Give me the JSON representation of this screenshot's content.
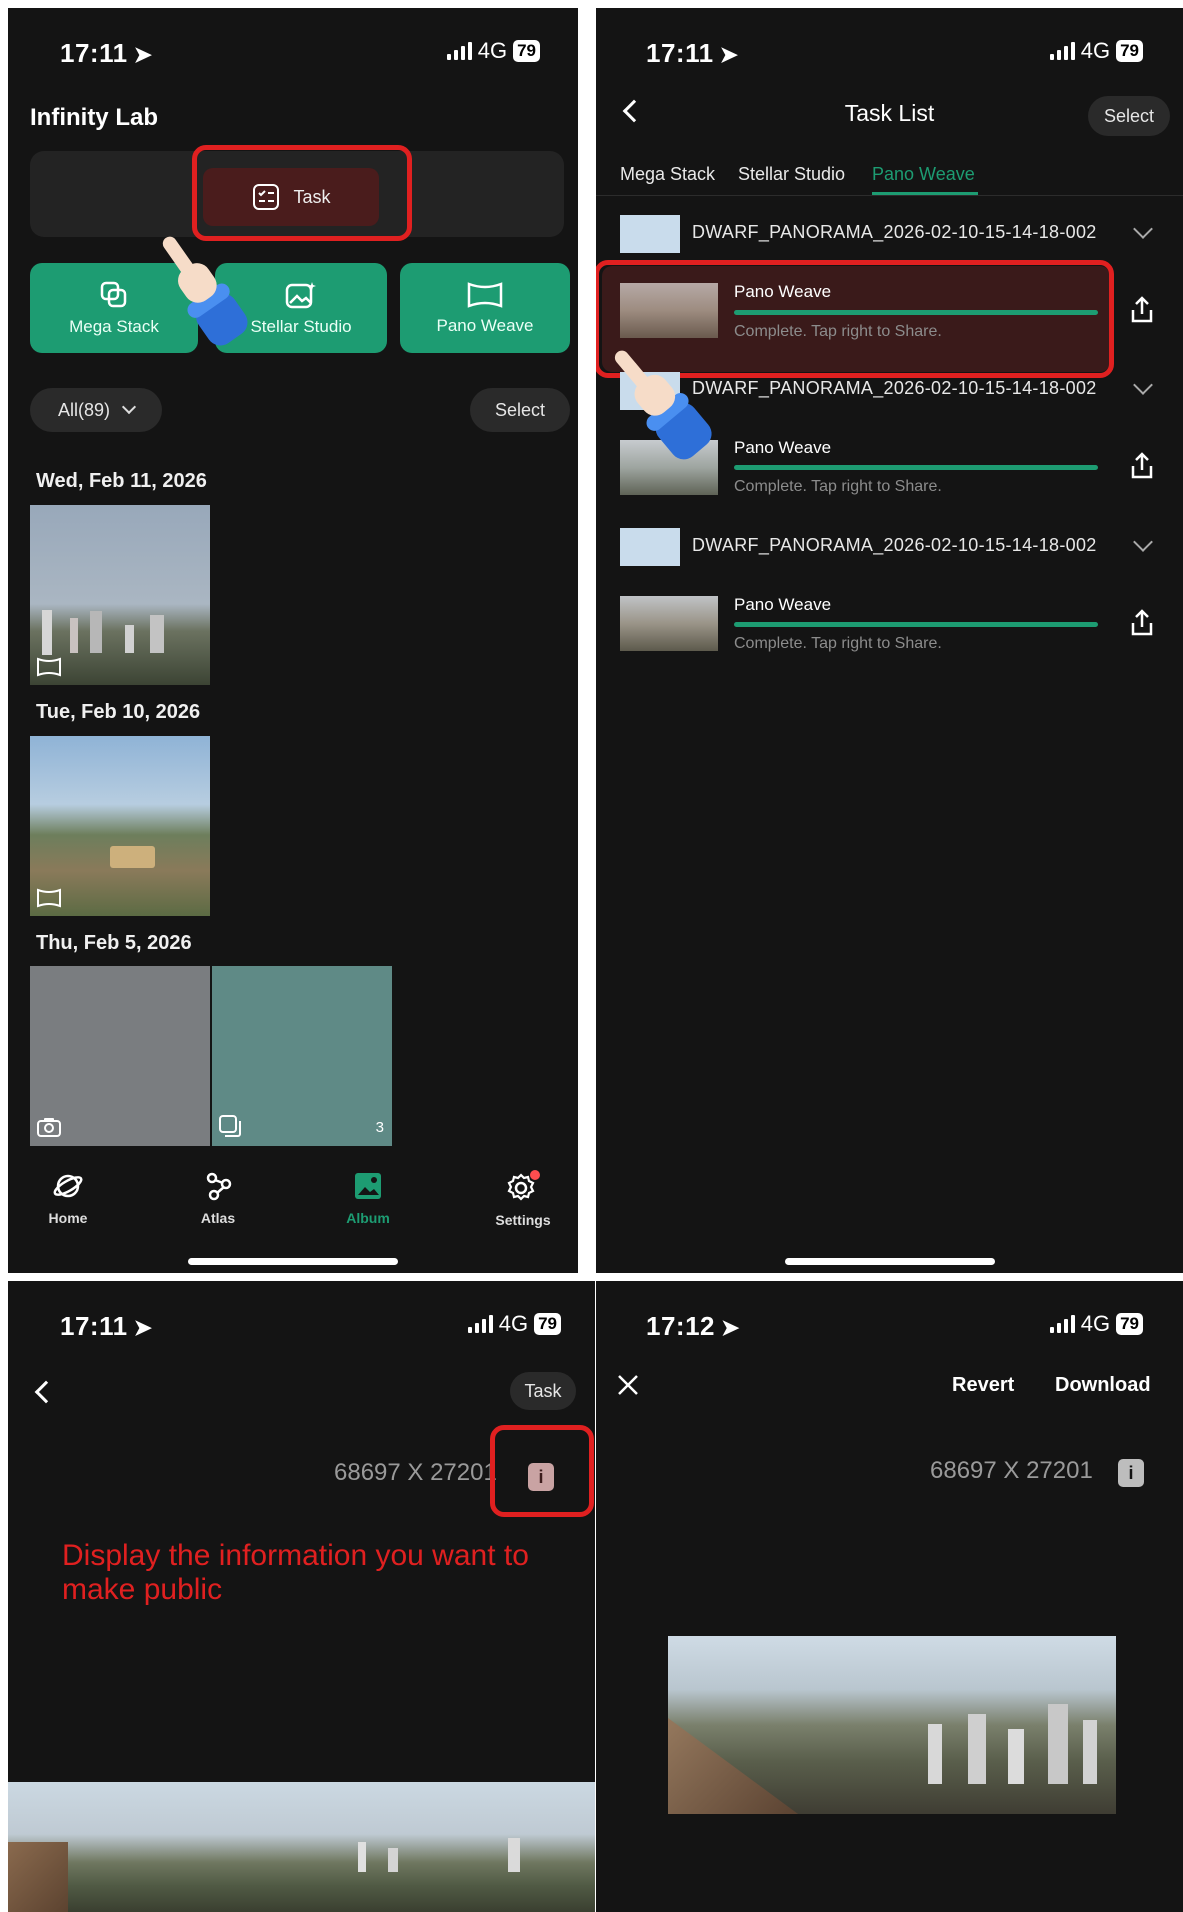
{
  "colors": {
    "accent": "#1d9c72",
    "highlight": "#e02020",
    "background": "#141414"
  },
  "status_bars": [
    {
      "time": "17:11",
      "network": "4G",
      "battery": "79"
    },
    {
      "time": "17:11",
      "network": "4G",
      "battery": "79"
    },
    {
      "time": "17:11",
      "network": "4G",
      "battery": "79"
    },
    {
      "time": "17:12",
      "network": "4G",
      "battery": "79"
    }
  ],
  "album": {
    "title": "Infinity Lab",
    "task_label": "Task",
    "tools": [
      {
        "label": "Mega Stack",
        "icon": "stack-icon"
      },
      {
        "label": "Stellar Studio",
        "icon": "magic-image-icon"
      },
      {
        "label": "Pano Weave",
        "icon": "panorama-icon"
      }
    ],
    "filter_label": "All(89)",
    "select_label": "Select",
    "sections": [
      {
        "date": "Wed, Feb 11, 2026"
      },
      {
        "date": "Tue, Feb 10, 2026"
      },
      {
        "date": "Thu, Feb 5, 2026",
        "count": "3"
      }
    ],
    "nav": [
      {
        "label": "Home",
        "icon": "planet-icon"
      },
      {
        "label": "Atlas",
        "icon": "atlas-icon"
      },
      {
        "label": "Album",
        "icon": "album-icon"
      },
      {
        "label": "Settings",
        "icon": "gear-icon"
      }
    ]
  },
  "task_list": {
    "title": "Task List",
    "select_label": "Select",
    "tabs": [
      "Mega Stack",
      "Stellar Studio",
      "Pano Weave"
    ],
    "active_tab": "Pano Weave",
    "groups": [
      {
        "name": "DWARF_PANORAMA_2026-02-10-15-14-18-002",
        "task": "Pano Weave",
        "status": "Complete. Tap right to Share."
      },
      {
        "name": "DWARF_PANORAMA_2026-02-10-15-14-18-002",
        "task": "Pano Weave",
        "status": "Complete. Tap right to Share."
      },
      {
        "name": "DWARF_PANORAMA_2026-02-10-15-14-18-002",
        "task": "Pano Weave",
        "status": "Complete. Tap right to Share."
      }
    ]
  },
  "viewer": {
    "task_label": "Task",
    "dimensions": "68697 X 27201",
    "note": "Display the information you want to make public"
  },
  "editor": {
    "revert_label": "Revert",
    "download_label": "Download",
    "dimensions": "68697 X 27201"
  }
}
